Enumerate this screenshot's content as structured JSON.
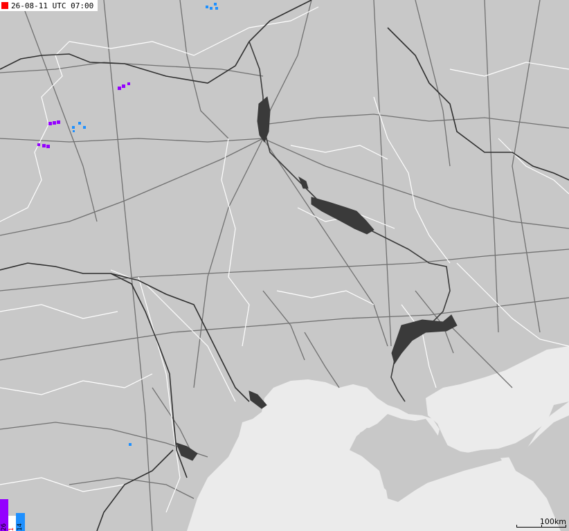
{
  "header": {
    "timestamp": "26-08-11 UTC 07:00"
  },
  "legend": {
    "bars": [
      {
        "label": "26",
        "color": "#9400ff"
      },
      {
        "label": "1",
        "color": "#ff0000"
      },
      {
        "label": "14",
        "color": "#1e90ff"
      }
    ]
  },
  "scale": {
    "label": "100km"
  },
  "colors": {
    "land": "#c8c8c8",
    "sea": "#ebebeb",
    "water": "#3a3a3a",
    "roads": "#6f6f6f",
    "borders": "#ffffff",
    "strike_old": "#9400ff",
    "strike_recent": "#1e90ff"
  }
}
